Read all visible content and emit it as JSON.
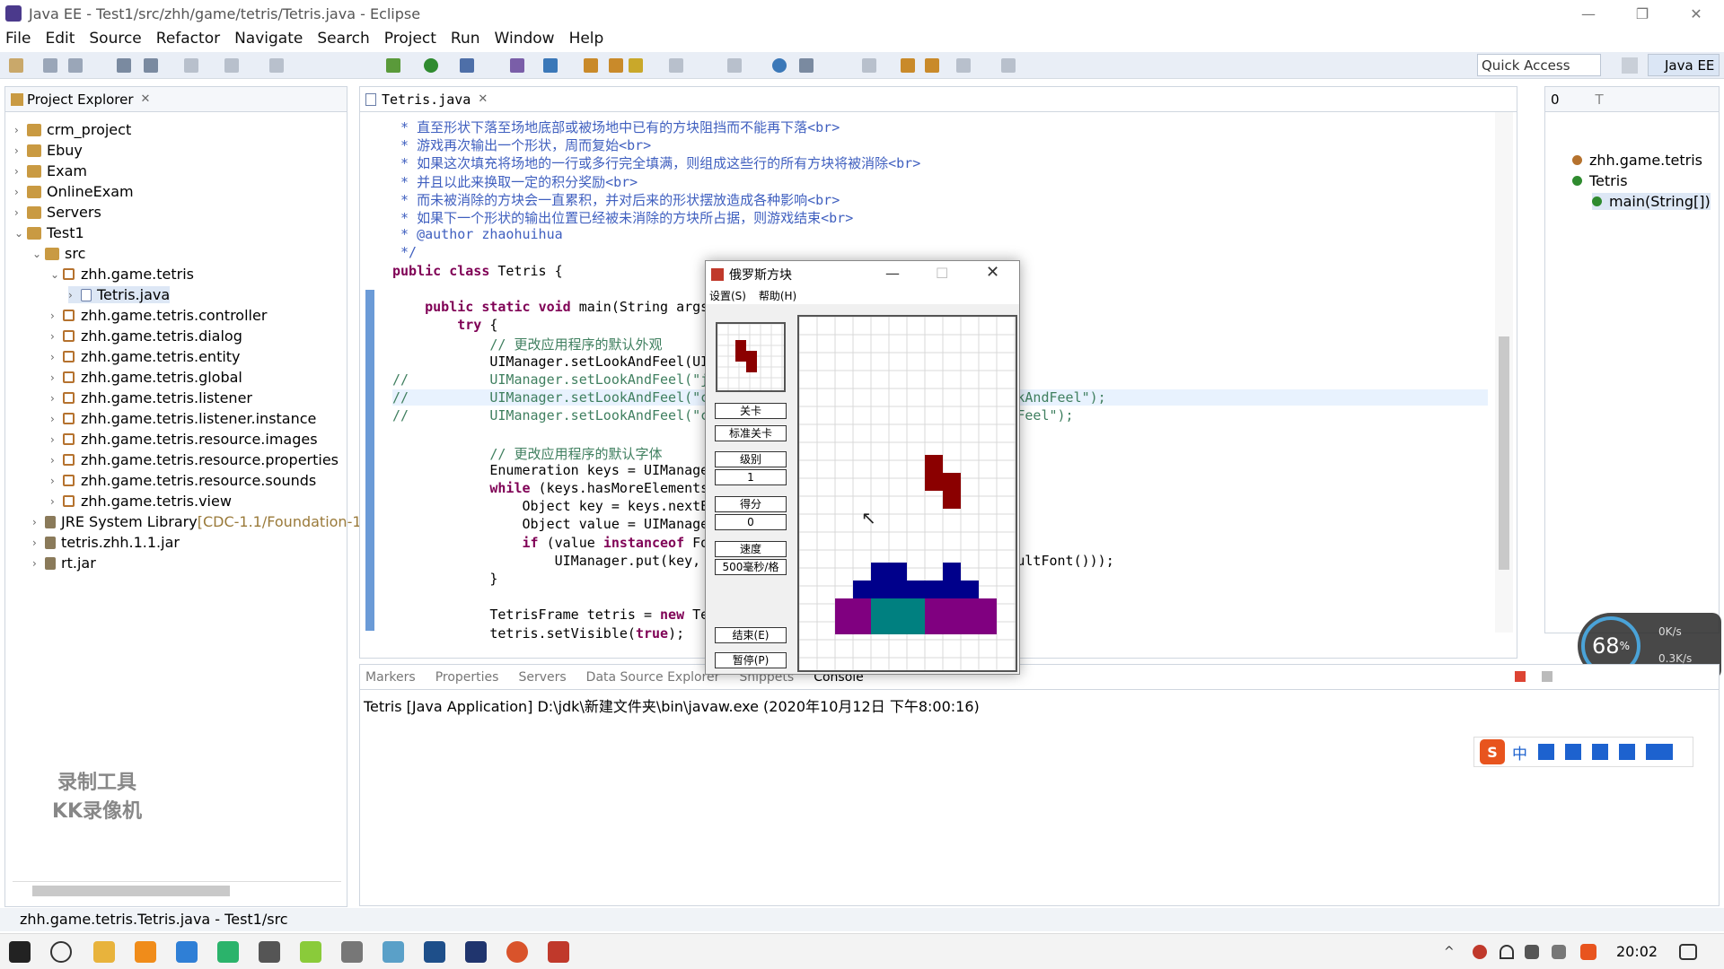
{
  "window": {
    "title": "Java EE - Test1/src/zhh/game/tetris/Tetris.java - Eclipse"
  },
  "menu": [
    "File",
    "Edit",
    "Source",
    "Refactor",
    "Navigate",
    "Search",
    "Project",
    "Run",
    "Window",
    "Help"
  ],
  "quick_access": "Quick Access",
  "perspective": "Java EE",
  "explorer": {
    "tab": "Project Explorer",
    "items": [
      {
        "label": "crm_project",
        "depth": 0,
        "type": "project",
        "arrow": "›"
      },
      {
        "label": "Ebuy",
        "depth": 0,
        "type": "project",
        "arrow": "›"
      },
      {
        "label": "Exam",
        "depth": 0,
        "type": "project",
        "arrow": "›"
      },
      {
        "label": "OnlineExam",
        "depth": 0,
        "type": "project",
        "arrow": "›"
      },
      {
        "label": "Servers",
        "depth": 0,
        "type": "project",
        "arrow": "›"
      },
      {
        "label": "Test1",
        "depth": 0,
        "type": "project",
        "arrow": "⌄"
      },
      {
        "label": "src",
        "depth": 1,
        "type": "project",
        "arrow": "⌄"
      },
      {
        "label": "zhh.game.tetris",
        "depth": 2,
        "type": "package",
        "arrow": "⌄"
      },
      {
        "label": "Tetris.java",
        "depth": 3,
        "type": "file",
        "arrow": "›",
        "selected": true
      },
      {
        "label": "zhh.game.tetris.controller",
        "depth": 2,
        "type": "package",
        "arrow": "›"
      },
      {
        "label": "zhh.game.tetris.dialog",
        "depth": 2,
        "type": "package",
        "arrow": "›"
      },
      {
        "label": "zhh.game.tetris.entity",
        "depth": 2,
        "type": "package",
        "arrow": "›"
      },
      {
        "label": "zhh.game.tetris.global",
        "depth": 2,
        "type": "package",
        "arrow": "›"
      },
      {
        "label": "zhh.game.tetris.listener",
        "depth": 2,
        "type": "package",
        "arrow": "›"
      },
      {
        "label": "zhh.game.tetris.listener.instance",
        "depth": 2,
        "type": "package",
        "arrow": "›"
      },
      {
        "label": "zhh.game.tetris.resource.images",
        "depth": 2,
        "type": "package",
        "arrow": "›"
      },
      {
        "label": "zhh.game.tetris.resource.properties",
        "depth": 2,
        "type": "package",
        "arrow": "›"
      },
      {
        "label": "zhh.game.tetris.resource.sounds",
        "depth": 2,
        "type": "package",
        "arrow": "›"
      },
      {
        "label": "zhh.game.tetris.view",
        "depth": 2,
        "type": "package",
        "arrow": "›"
      },
      {
        "label": "JRE System Library",
        "suffix": "[CDC-1.1/Foundation-1",
        "depth": 1,
        "type": "lib",
        "arrow": "›"
      },
      {
        "label": "tetris.zhh.1.1.jar",
        "depth": 1,
        "type": "jar",
        "arrow": "›"
      },
      {
        "label": "rt.jar",
        "depth": 1,
        "type": "jar",
        "arrow": "›"
      }
    ]
  },
  "editor": {
    "tab": "Tetris.java",
    "lines": [
      {
        "t": " * 直至形状下落至场地底部或被场地中已有的方块阻挡而不能再下落<br>",
        "c": "jd"
      },
      {
        "t": " * 游戏再次输出一个形状，周而复始<br>",
        "c": "jd"
      },
      {
        "t": " * 如果这次填充将场地的一行或多行完全填满，则组成这些行的所有方块将被消除<br>",
        "c": "jd"
      },
      {
        "t": " * 并且以此来换取一定的积分奖励<br>",
        "c": "jd"
      },
      {
        "t": " * 而未被消除的方块会一直累积，并对后来的形状摆放造成各种影响<br>",
        "c": "jd"
      },
      {
        "t": " * 如果下一个形状的输出位置已经被未消除的方块所占据，则游戏结束<br>",
        "c": "jd"
      },
      {
        "t": " * @author zhaohuihua",
        "c": "jd"
      },
      {
        "t": " */",
        "c": "jd"
      },
      {
        "t": "public class Tetris {",
        "c": ""
      },
      {
        "t": "",
        "c": ""
      },
      {
        "t": "    public static void main(String args",
        "c": ""
      },
      {
        "t": "        try {",
        "c": ""
      },
      {
        "t": "            // 更改应用程序的默认外观",
        "c": "cm"
      },
      {
        "t": "            UIManager.setLookAndFeel(UI                                    );",
        "c": ""
      },
      {
        "t": "//          UIManager.setLookAndFeel(\"j                                    );",
        "c": "cm"
      },
      {
        "t": "//          UIManager.setLookAndFeel(\"c                                    ookAndFeel\");",
        "c": "cm"
      },
      {
        "t": "//          UIManager.setLookAndFeel(\"c                                    ndFeel\");",
        "c": "cm"
      },
      {
        "t": "",
        "c": ""
      },
      {
        "t": "            // 更改应用程序的默认字体",
        "c": "cm"
      },
      {
        "t": "            Enumeration keys = UIManage",
        "c": ""
      },
      {
        "t": "            while (keys.hasMoreElements",
        "c": ""
      },
      {
        "t": "                Object key = keys.nextE",
        "c": ""
      },
      {
        "t": "                Object value = UIManage",
        "c": ""
      },
      {
        "t": "                if (value instanceof Fo",
        "c": ""
      },
      {
        "t": "                    UIManager.put(key,                                    efaultFont()));",
        "c": ""
      },
      {
        "t": "            }",
        "c": ""
      },
      {
        "t": "",
        "c": ""
      },
      {
        "t": "            TetrisFrame tetris = new Te",
        "c": ""
      },
      {
        "t": "            tetris.setVisible(true);",
        "c": ""
      }
    ]
  },
  "outline": {
    "tab": "0",
    "tab2": "T",
    "items": [
      {
        "label": "zhh.game.tetris",
        "depth": 0
      },
      {
        "label": "Tetris",
        "depth": 0
      },
      {
        "label": "main(String[])",
        "depth": 1
      }
    ]
  },
  "bottom": {
    "tabs": [
      "Markers",
      "Properties",
      "Servers",
      "Data Source Explorer",
      "Snippets",
      "Console"
    ],
    "console_line": "Tetris [Java Application] D:\\jdk\\新建文件夹\\bin\\javaw.exe (2020年10月12日 下午8:00:16)"
  },
  "status": {
    "text": "zhh.game.tetris.Tetris.java - Test1/src"
  },
  "netwidget": {
    "percent": "68",
    "pct_sign": "%",
    "up": "0K/s",
    "down": "0.3K/s"
  },
  "watermark": {
    "line1": "录制工具",
    "line2": "KK录像机"
  },
  "ime": {
    "label": "中"
  },
  "tetris": {
    "title": "俄罗斯方块",
    "menu": [
      "设置(S)",
      "帮助(H)"
    ],
    "btn_level": "关卡",
    "btn_std": "标准关卡",
    "lbl_rank": "级别",
    "val_rank": "1",
    "lbl_score": "得分",
    "val_score": "0",
    "lbl_speed": "速度",
    "val_speed": "500毫秒/格",
    "btn_end": "结束(E)",
    "btn_pause": "暂停(P)"
  },
  "clock": {
    "time": "20:02"
  },
  "colors": {
    "accent": "#1d62cf",
    "piece_red": "#8b0000",
    "piece_blue": "#00008b",
    "piece_purple": "#800080",
    "piece_teal": "#008080"
  }
}
